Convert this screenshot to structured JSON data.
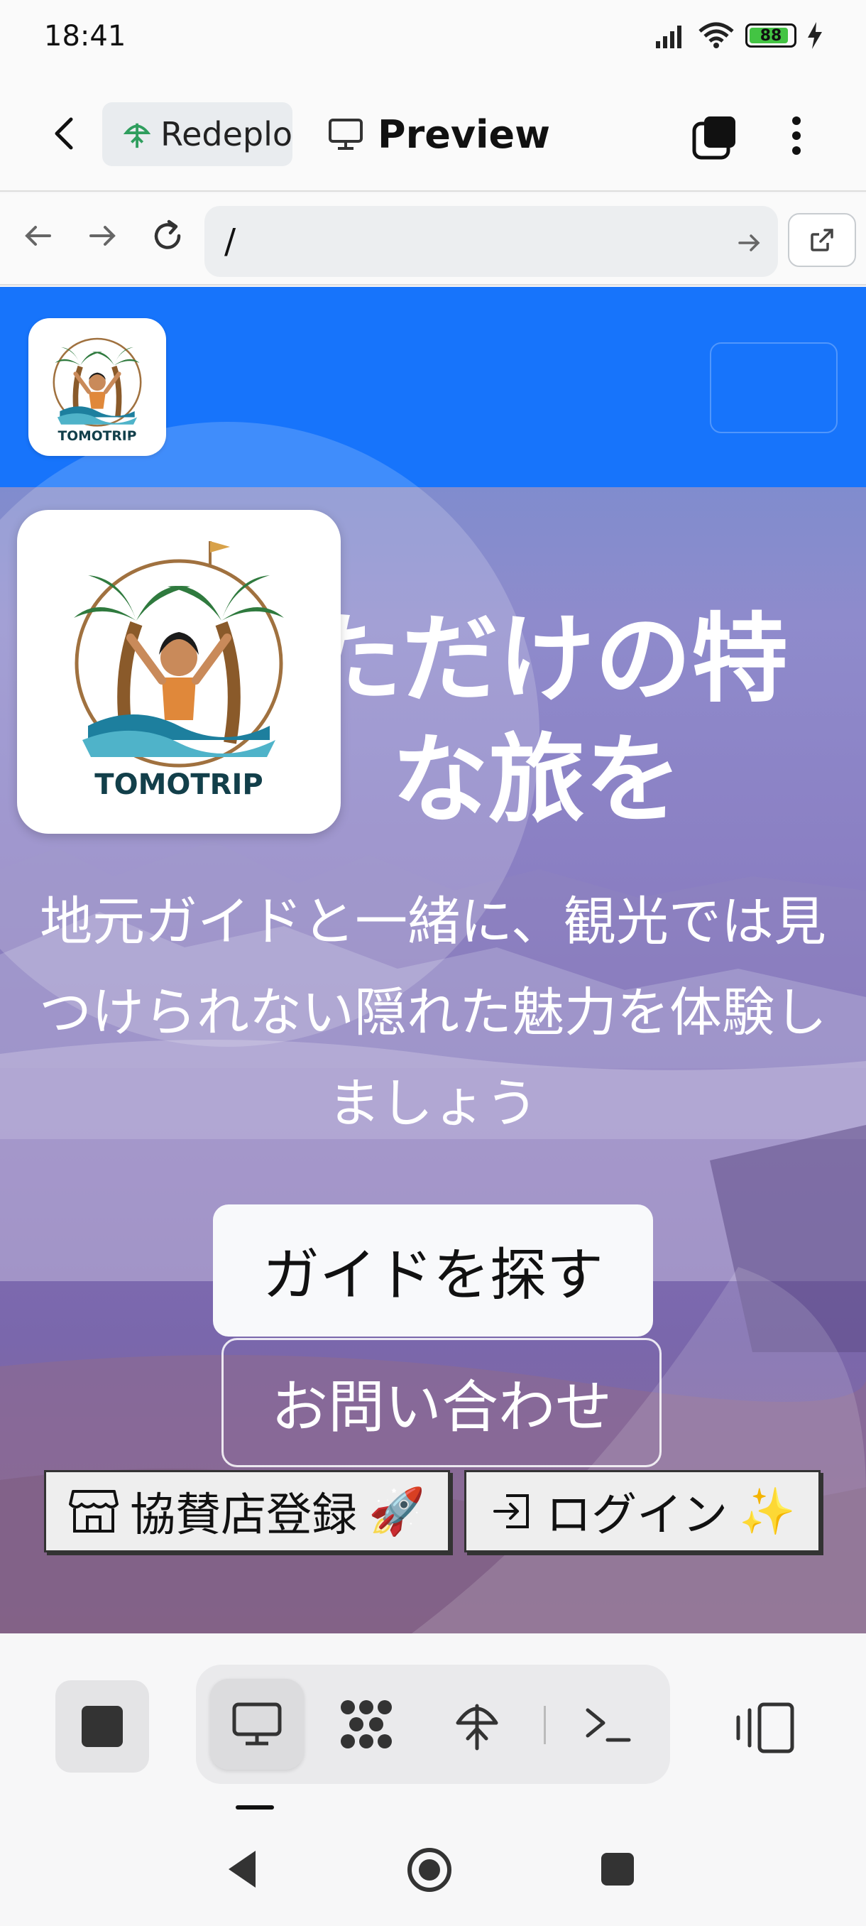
{
  "status_bar": {
    "time": "18:41",
    "battery": "88",
    "icons": [
      "signal-icon",
      "wifi-icon",
      "battery-icon",
      "charging-icon"
    ]
  },
  "app_header": {
    "tab_repl": "Redeplo",
    "tab_preview": "Preview"
  },
  "url_bar": {
    "url": "/"
  },
  "site": {
    "brand_small": "TOMOTRIP",
    "brand_big": "TOMOTRIP",
    "hero_title_line1": "ただけの特",
    "hero_title_line2": "な旅を",
    "subtitle": "地元ガイドと一緒に、観光では見つけられない隠れた魅力を体験しましょう",
    "cta_find_guide": "ガイドを探す",
    "cta_contact": "お問い合わせ",
    "sponsor_label": "協賛店登録",
    "sponsor_emoji": "🚀",
    "login_label": "ログイン",
    "login_emoji": "✨"
  },
  "colors": {
    "header_blue": "#1774fb",
    "accent_palm": "#2f7a3e",
    "text_dark_teal": "#123f4a"
  }
}
